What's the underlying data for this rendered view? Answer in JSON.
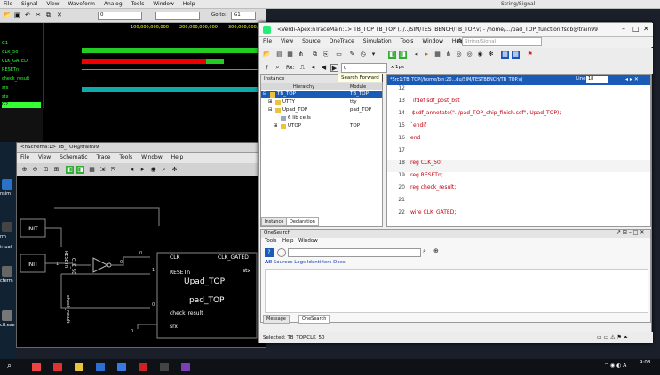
{
  "wave": {
    "menu": [
      "File",
      "Signal",
      "View",
      "Waveform",
      "Analog",
      "Tools",
      "Window",
      "Help"
    ],
    "time_input": "0",
    "go_to_label": "Go to:",
    "go_to_value": "G1",
    "search_placeholder": "String/Signal",
    "signals": [
      "G1",
      "CLK_50",
      "CLK_GATED",
      "RESETn",
      "check_result",
      "srx",
      "stx",
      "G2"
    ],
    "timestamps": [
      "100,000,000,000",
      "200,000,000,000",
      "300,000,000,000"
    ]
  },
  "desktop": {
    "labels": [
      "nsim",
      "rm",
      "irtual",
      "cterm",
      "ctl.exe"
    ]
  },
  "schematic": {
    "title": "<nSchema:1> TB_TOP@train99",
    "menu": [
      "File",
      "View",
      "Schematic",
      "Trace",
      "Tools",
      "Window",
      "Help"
    ],
    "blocks": {
      "init1": "INIT",
      "init2": "INIT",
      "pad_top_label": "Upad_TOP",
      "pad_top_name": "pad_TOP"
    },
    "pins": {
      "clk": "CLK",
      "resetn": "RESETn",
      "check_result": "check_result",
      "srx": "srx",
      "clk_gated": "CLK_GATED",
      "stx": "stx"
    },
    "net_labels": [
      "RESETn",
      "CLK_50",
      "check_result"
    ],
    "wire_values": [
      "0",
      "0",
      "1",
      "0",
      "0",
      "1"
    ]
  },
  "verdi": {
    "title": "<Verdi-Apex:nTraceMain:1> TB_TOP TB_TOP (../../SIM/TESTBENCH/TB_TOP.v) - /home/.../pad_TOP_function.fsdb@train99",
    "menu": [
      "File",
      "View",
      "Source",
      "OneTrace",
      "Simulation",
      "Tools",
      "Window",
      "Help"
    ],
    "search_placeholder": "String/Signal",
    "rx_label": "Rx:",
    "time_label": "x 1ps",
    "tooltip": "Search Forward",
    "instance_header": "Instance",
    "hierarchy_col": "Hierarchy",
    "module_col": "Module",
    "tree": [
      {
        "name": "TB_TOP",
        "module": "TB_TOP"
      },
      {
        "name": "UTTY",
        "module": "tty"
      },
      {
        "name": "Upad_TOP",
        "module": "pad_TOP"
      },
      {
        "name": "6 lib cells",
        "module": ""
      },
      {
        "name": "UTOP",
        "module": "TOP"
      }
    ],
    "inst_tabs": [
      "Instance",
      "Declaration"
    ],
    "source_path": "*Src1:TB_TOP(/home/bin:20...du/SIM/TESTBENCH/TB_TOP.v)",
    "line_label": "Line",
    "line_value": "18",
    "source_lines": [
      {
        "num": "12",
        "text": ""
      },
      {
        "num": "13",
        "text": "`ifdef sdf_post_bst"
      },
      {
        "num": "14",
        "text": "  $sdf_annotate(\"../pad_TOP_chip_finish.sdf\", Upad_TOP);"
      },
      {
        "num": "15",
        "text": "`endif"
      },
      {
        "num": "16",
        "text": "end"
      },
      {
        "num": "17",
        "text": ""
      },
      {
        "num": "18",
        "text": "reg CLK_50;"
      },
      {
        "num": "19",
        "text": "reg RESETn;"
      },
      {
        "num": "20",
        "text": "reg check_result;"
      },
      {
        "num": "21",
        "text": ""
      },
      {
        "num": "22",
        "text": "wire CLK_GATED;"
      }
    ],
    "onesearch": {
      "title": "OneSearch",
      "menu": [
        "Tools",
        "Help",
        "Window"
      ],
      "filters": [
        "All",
        "Sources",
        "Logs",
        "Identifiers",
        "Docs"
      ]
    },
    "bottom_tabs": [
      "Message",
      "OneSearch"
    ],
    "status": "Selected: TB_TOP.CLK_50"
  },
  "taskbar": {
    "time": "9:08"
  }
}
